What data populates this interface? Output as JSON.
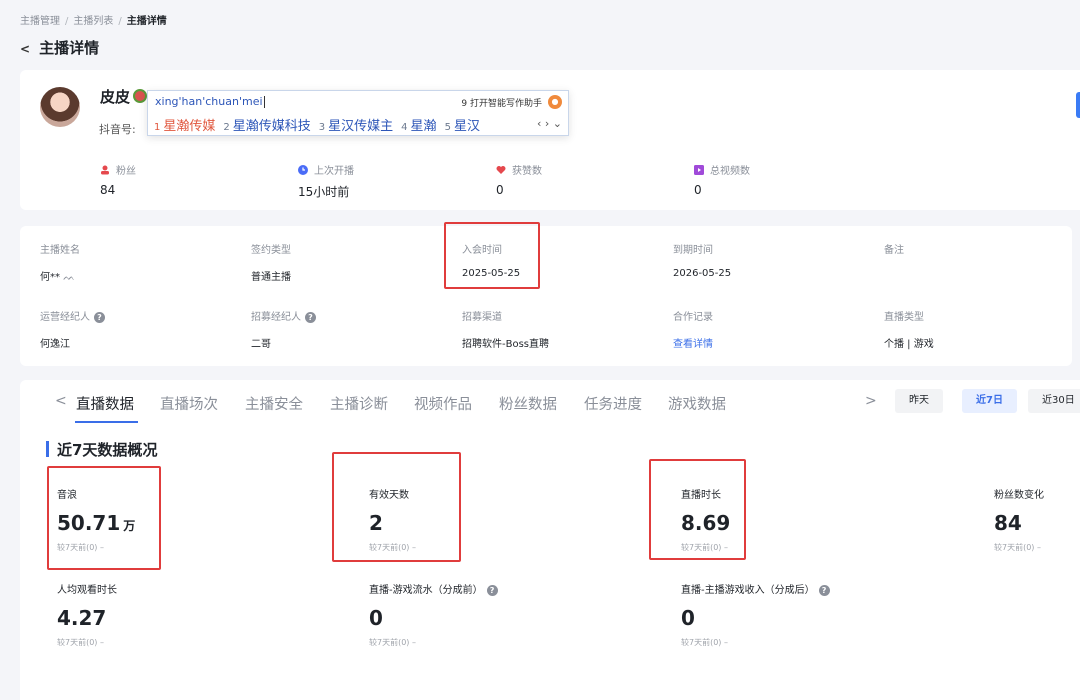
{
  "breadcrumb": {
    "items": [
      "主播管理",
      "主播列表",
      "主播详情"
    ]
  },
  "page_title": "主播详情",
  "profile": {
    "name": "皮皮",
    "douyin_label": "抖音号:",
    "stats": [
      {
        "label": "粉丝",
        "value": "84",
        "icon": "fans-icon",
        "color": "#e5484d"
      },
      {
        "label": "上次开播",
        "value": "15小时前",
        "icon": "clock-icon",
        "color": "#4a6cf7"
      },
      {
        "label": "获赞数",
        "value": "0",
        "icon": "heart-icon",
        "color": "#e5484d"
      },
      {
        "label": "总视频数",
        "value": "0",
        "icon": "video-icon",
        "color": "#a04ad9"
      }
    ]
  },
  "ime": {
    "input": "xing'han'chuan'mei",
    "assistant": "9 打开智能写作助手",
    "candidates": [
      {
        "num": "1",
        "text": "星瀚传媒"
      },
      {
        "num": "2",
        "text": "星瀚传媒科技"
      },
      {
        "num": "3",
        "text": "星汉传媒主"
      },
      {
        "num": "4",
        "text": "星瀚"
      },
      {
        "num": "5",
        "text": "星汉"
      }
    ],
    "nav": "‹ › ⌄"
  },
  "info": {
    "row1": [
      {
        "label": "主播姓名",
        "value": "何**"
      },
      {
        "label": "签约类型",
        "value": "普通主播"
      },
      {
        "label": "入会时间",
        "value": "2025-05-25"
      },
      {
        "label": "到期时间",
        "value": "2026-05-25"
      },
      {
        "label": "备注",
        "value": ""
      }
    ],
    "row2": [
      {
        "label": "运营经纪人",
        "value": "何逸江"
      },
      {
        "label": "招募经纪人",
        "value": "二哥"
      },
      {
        "label": "招募渠道",
        "value": "招聘软件-Boss直聘"
      },
      {
        "label": "合作记录",
        "value": "查看详情"
      },
      {
        "label": "直播类型",
        "value": "个播 | 游戏"
      }
    ]
  },
  "tabs": [
    "直播数据",
    "直播场次",
    "主播安全",
    "主播诊断",
    "视频作品",
    "粉丝数据",
    "任务进度",
    "游戏数据"
  ],
  "periods": [
    "昨天",
    "近7日",
    "近30日"
  ],
  "section_title": "近7天数据概况",
  "metrics": [
    {
      "label": "音浪",
      "value": "50.71",
      "unit": "万",
      "cmp": "较7天前(0) –"
    },
    {
      "label": "有效天数",
      "value": "2",
      "unit": "",
      "cmp": "较7天前(0) –"
    },
    {
      "label": "直播时长",
      "value": "8.69",
      "unit": "",
      "cmp": "较7天前(0) –"
    },
    {
      "label": "粉丝数变化",
      "value": "84",
      "unit": "",
      "cmp": "较7天前(0) –"
    },
    {
      "label": "人均观看时长",
      "value": "4.27",
      "unit": "",
      "cmp": "较7天前(0) –"
    },
    {
      "label": "直播-游戏流水（分成前）",
      "value": "0",
      "unit": "",
      "cmp": "较7天前(0) –"
    },
    {
      "label": "直播-主播游戏收入（分成后）",
      "value": "0",
      "unit": "",
      "cmp": "较7天前(0) –"
    }
  ],
  "colors": {
    "accent": "#3a6ee8",
    "highlight": "#e03c3c"
  }
}
